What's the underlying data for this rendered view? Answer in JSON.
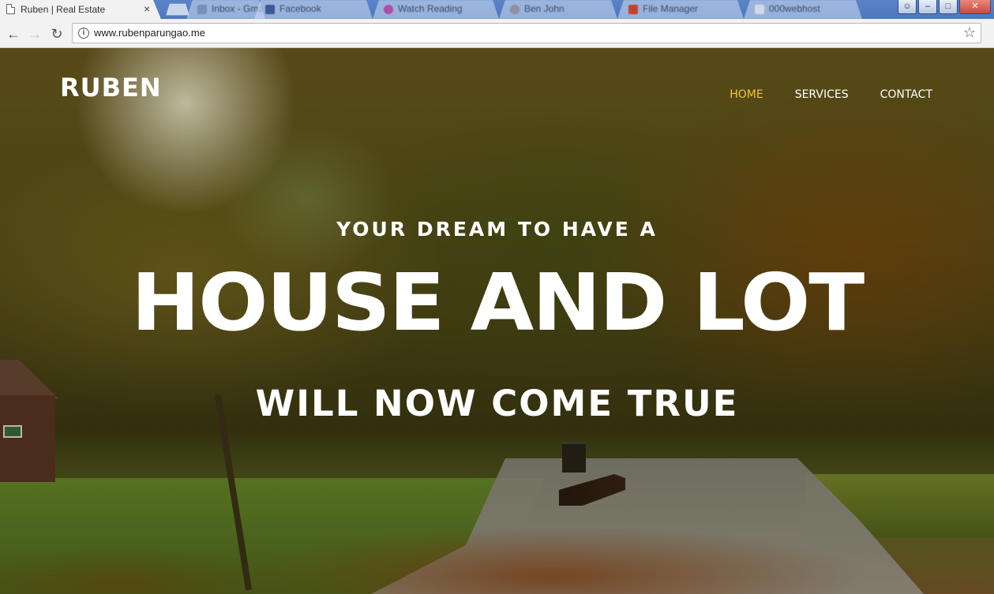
{
  "browser": {
    "active_tab": {
      "title": "Ruben | Real Estate",
      "close": "×"
    },
    "background_tabs": [
      {
        "title": "Inbox - Gmail",
        "favicon_color": "#7a8fb5"
      },
      {
        "title": "Facebook",
        "favicon_color": "#3b5998"
      },
      {
        "title": "Watch Reading",
        "favicon_color": "#b24ca8"
      },
      {
        "title": "Ben John",
        "favicon_color": "#8f8fa0"
      },
      {
        "title": "File Manager",
        "favicon_color": "#c2432c"
      },
      {
        "title": "000webhost",
        "favicon_color": "#cfd9ea"
      }
    ],
    "window_controls": {
      "user": "☺",
      "minimize": "–",
      "maximize": "□",
      "close": "✕"
    },
    "nav": {
      "back": "←",
      "forward": "→",
      "reload": "↻"
    },
    "address": "www.rubenparungao.me",
    "info_icon": "i",
    "bookmark_icon": "☆"
  },
  "site": {
    "brand": "RUBEN",
    "nav_items": [
      {
        "label": "HOME",
        "active": true
      },
      {
        "label": "SERVICES",
        "active": false
      },
      {
        "label": "CONTACT",
        "active": false
      }
    ],
    "hero": {
      "subtitle": "YOUR DREAM TO HAVE A",
      "title": "HOUSE AND LOT",
      "tagline": "WILL NOW COME TRUE"
    },
    "shed_sign": ""
  },
  "colors": {
    "active_nav": "#f4c430",
    "text": "#ffffff",
    "chrome_tabstrip": "#4d77be"
  }
}
